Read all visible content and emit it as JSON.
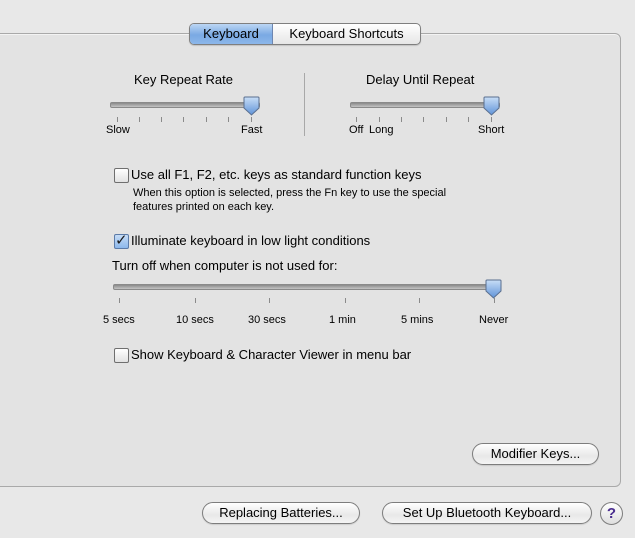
{
  "tabs": [
    {
      "label": "Keyboard",
      "active": true
    },
    {
      "label": "Keyboard Shortcuts",
      "active": false
    }
  ],
  "key_repeat": {
    "title": "Key Repeat Rate",
    "min_label": "Slow",
    "max_label": "Fast",
    "value": 1.0
  },
  "delay_repeat": {
    "title": "Delay Until Repeat",
    "min_label": "Off",
    "min_label2": "Long",
    "max_label": "Short",
    "value": 1.0
  },
  "fn_keys": {
    "label": "Use all F1, F2, etc. keys as standard function keys",
    "checked": false,
    "description_line1": "When this option is selected, press the Fn key to use the special",
    "description_line2": "features printed on each key."
  },
  "illuminate": {
    "label": "Illuminate keyboard in low light conditions",
    "checked": true
  },
  "turn_off": {
    "label": "Turn off when computer is not used for:",
    "ticks": [
      "5 secs",
      "10 secs",
      "30 secs",
      "1 min",
      "5 mins",
      "Never"
    ],
    "selected": "Never"
  },
  "viewer": {
    "label": "Show Keyboard & Character Viewer in menu bar",
    "checked": false
  },
  "buttons": {
    "modifier": "Modifier Keys...",
    "batteries": "Replacing Batteries...",
    "bluetooth": "Set Up Bluetooth Keyboard...",
    "help": "?"
  },
  "colors": {
    "accent": "#7aa9e3",
    "help_glyph": "#4a2d8f"
  }
}
